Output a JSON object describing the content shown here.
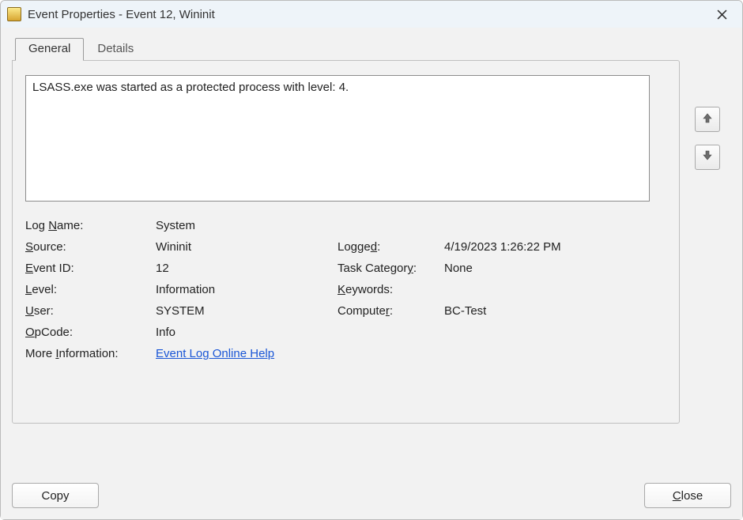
{
  "window": {
    "title": "Event Properties - Event 12, Wininit"
  },
  "tabs": {
    "general": "General",
    "details": "Details"
  },
  "description": "LSASS.exe was started as a protected process with level: 4.",
  "fields": {
    "logName": {
      "label_pre": "Log ",
      "label_u": "N",
      "label_post": "ame:",
      "value": "System"
    },
    "source": {
      "label_u": "S",
      "label_post": "ource:",
      "value": "Wininit"
    },
    "logged": {
      "label_pre": "Logge",
      "label_u": "d",
      "label_post": ":",
      "value": "4/19/2023 1:26:22 PM"
    },
    "eventId": {
      "label_u": "E",
      "label_post": "vent ID:",
      "value": "12"
    },
    "taskCat": {
      "label_pre": "Task Categor",
      "label_u": "y",
      "label_post": ":",
      "value": "None"
    },
    "level": {
      "label_u": "L",
      "label_post": "evel:",
      "value": "Information"
    },
    "keywords": {
      "label_u": "K",
      "label_post": "eywords:",
      "value": ""
    },
    "user": {
      "label_u": "U",
      "label_post": "ser:",
      "value": "SYSTEM"
    },
    "computer": {
      "label_pre": "Compute",
      "label_u": "r",
      "label_post": ":",
      "value": "BC-Test"
    },
    "opcode": {
      "label_u": "O",
      "label_post": "pCode:",
      "value": "Info"
    },
    "moreInfo": {
      "label_pre": "More ",
      "label_u": "I",
      "label_post": "nformation:",
      "link": "Event Log Online Help"
    }
  },
  "buttons": {
    "copy": "Copy",
    "close_u": "C",
    "close_rest": "lose"
  }
}
